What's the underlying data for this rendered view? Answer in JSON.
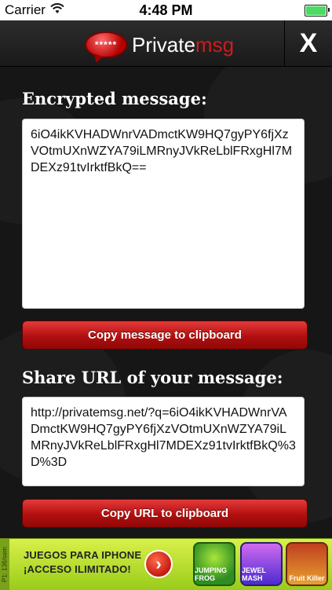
{
  "status_bar": {
    "carrier": "Carrier",
    "time": "4:48 PM",
    "battery_level": 1.0
  },
  "navbar": {
    "logo_bubble": "*****",
    "logo_text_main": "Private",
    "logo_text_accent": "msg",
    "close_label": "X"
  },
  "encrypted": {
    "title": "Encrypted message:",
    "text": "6iO4ikKVHADWnrVADmctKW9HQ7gyPY6fjXzVOtmUXnWZYA79iLMRnyJVkReLblFRxgHl7MDEXz91tvIrktfBkQ==",
    "copy_button": "Copy message to clipboard"
  },
  "share": {
    "title": "Share URL of your message:",
    "url": "http://privatemsg.net/?q=6iO4ikKVHADWnrVADmctKW9HQ7gyPY6fjXzVOtmUXnWZYA79iLMRnyJVkReLblFRxgHl7MDEXz91tvIrktfBkQ%3D%3D",
    "copy_button": "Copy URL to clipboard"
  },
  "ad": {
    "side_label": "P1: 136/sem",
    "line1": "JUEGOS PARA IPHONE",
    "line2": "¡ACCESO ILIMITADO!",
    "arrow": "›",
    "games": [
      "JUMPING FROG",
      "JEWEL MASH",
      "Fruit Killer"
    ]
  },
  "colors": {
    "accent_red": "#d11a1a",
    "button_red": "#b10f0f",
    "ad_green": "#99cc1a"
  }
}
